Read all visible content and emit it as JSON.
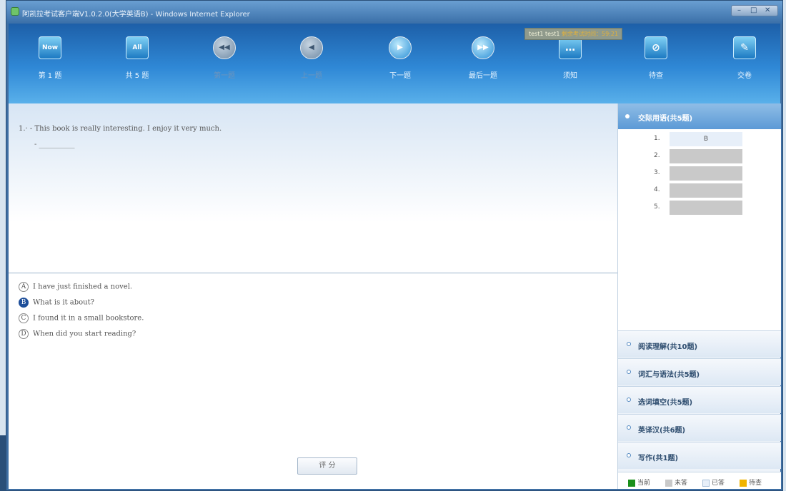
{
  "window": {
    "title": "阿凯拉考试客户端V1.0.2.0(大学英语B) - Windows Internet Explorer"
  },
  "toolbar": {
    "items": [
      {
        "label": "第 1 题",
        "icon": "now-icon",
        "glyph": "Now",
        "enabled": true
      },
      {
        "label": "共 5 题",
        "icon": "all-icon",
        "glyph": "All",
        "enabled": true
      },
      {
        "label": "第一题",
        "icon": "first-icon",
        "glyph": "◀◀",
        "enabled": false
      },
      {
        "label": "上一题",
        "icon": "prev-icon",
        "glyph": "◀",
        "enabled": false
      },
      {
        "label": "下一题",
        "icon": "next-icon",
        "glyph": "▶",
        "enabled": true
      },
      {
        "label": "最后一题",
        "icon": "last-icon",
        "glyph": "▶▶",
        "enabled": true
      },
      {
        "label": "须知",
        "icon": "notice-icon",
        "glyph": "…",
        "enabled": true
      },
      {
        "label": "待查",
        "icon": "mark-icon",
        "glyph": "⊘",
        "enabled": true
      },
      {
        "label": "交卷",
        "icon": "submit-icon",
        "glyph": "✎",
        "enabled": true
      }
    ],
    "tooltip": {
      "part1": "test1",
      "part2": "test1",
      "highlight": "剩余考试时间：59:21"
    }
  },
  "question": {
    "number": "1.",
    "text": "1.· - This book is really interesting. I enjoy it very much.",
    "blank": "- __________"
  },
  "options": [
    {
      "letter": "A",
      "text": "I have just finished a novel.",
      "selected": false
    },
    {
      "letter": "B",
      "text": "What is it about?",
      "selected": true
    },
    {
      "letter": "C",
      "text": "I found it in a small bookstore.",
      "selected": false
    },
    {
      "letter": "D",
      "text": "When did you start reading?",
      "selected": false
    }
  ],
  "score_button": "评 分",
  "sidebar": {
    "active_section": "交际用语(共5题)",
    "question_items": [
      {
        "num": "1.",
        "answer": "B",
        "status": "answered"
      },
      {
        "num": "2.",
        "answer": "",
        "status": "unanswered"
      },
      {
        "num": "3.",
        "answer": "",
        "status": "unanswered"
      },
      {
        "num": "4.",
        "answer": "",
        "status": "unanswered"
      },
      {
        "num": "5.",
        "answer": "",
        "status": "unanswered"
      }
    ],
    "sections": [
      {
        "label": "阅读理解(共10题)"
      },
      {
        "label": "词汇与语法(共5题)"
      },
      {
        "label": "选词填空(共5题)"
      },
      {
        "label": "英译汉(共6题)"
      },
      {
        "label": "写作(共1题)"
      }
    ],
    "legend": [
      {
        "label": "当前",
        "color": "#1a8f1a"
      },
      {
        "label": "未答",
        "color": "#c9c9c9"
      },
      {
        "label": "已答",
        "color": "#e7eff9"
      },
      {
        "label": "待查",
        "color": "#f0b400"
      }
    ]
  }
}
